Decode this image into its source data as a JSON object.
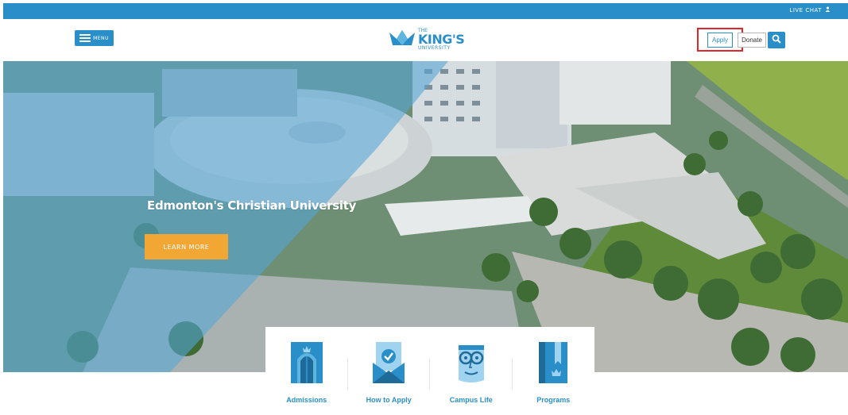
{
  "topbar": {
    "live_chat": "LIVE CHAT",
    "live_chat_icon": "person-icon"
  },
  "header": {
    "menu_label": "MENU",
    "logo": {
      "the": "THE",
      "kings": "KING'S",
      "university": "UNIVERSITY"
    },
    "apply_label": "Apply",
    "donate_label": "Donate",
    "search_icon": "search-icon"
  },
  "hero": {
    "title": "Edmonton's Christian University",
    "cta_label": "LEARN MORE"
  },
  "quick_links": [
    {
      "label": "Admissions",
      "icon": "door-icon"
    },
    {
      "label": "How to Apply",
      "icon": "envelope-check-icon"
    },
    {
      "label": "Campus Life",
      "icon": "face-glasses-icon"
    },
    {
      "label": "Programs",
      "icon": "book-icon"
    }
  ],
  "colors": {
    "brand_blue": "#2a8fc9",
    "cta_orange": "#f2a735",
    "highlight_red": "#e3262a"
  }
}
